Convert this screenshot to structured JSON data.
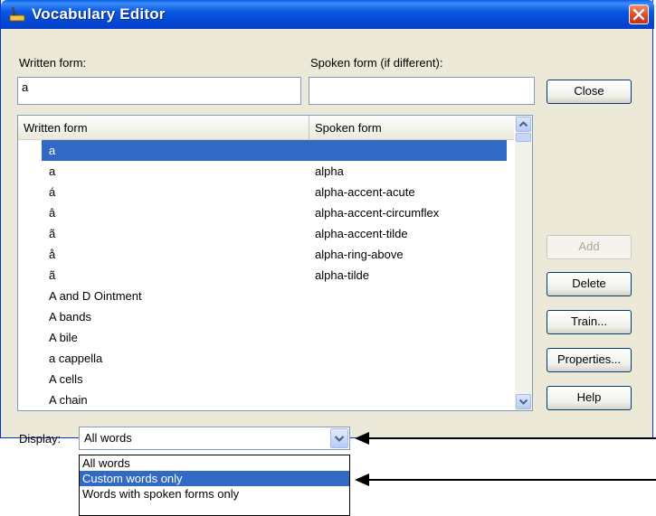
{
  "window": {
    "title": "Vocabulary Editor"
  },
  "labels": {
    "written_form": "Written form:",
    "spoken_form": "Spoken form (if different):",
    "display": "Display:"
  },
  "inputs": {
    "written_value": "a",
    "spoken_value": ""
  },
  "buttons": {
    "close": "Close",
    "add": "Add",
    "delete": "Delete",
    "train": "Train...",
    "properties": "Properties...",
    "help": "Help"
  },
  "list": {
    "columns": [
      "Written form",
      "Spoken form"
    ],
    "rows": [
      {
        "written": "a",
        "spoken": "",
        "selected": true
      },
      {
        "written": "a",
        "spoken": "alpha"
      },
      {
        "written": "á",
        "spoken": "alpha-accent-acute"
      },
      {
        "written": "â",
        "spoken": "alpha-accent-circumflex"
      },
      {
        "written": "ã",
        "spoken": "alpha-accent-tilde"
      },
      {
        "written": "å",
        "spoken": "alpha-ring-above"
      },
      {
        "written": "ã",
        "spoken": "alpha-tilde"
      },
      {
        "written": "A and D Ointment",
        "spoken": ""
      },
      {
        "written": "A bands",
        "spoken": ""
      },
      {
        "written": "A bile",
        "spoken": ""
      },
      {
        "written": "a cappella",
        "spoken": ""
      },
      {
        "written": "A cells",
        "spoken": ""
      },
      {
        "written": "A chain",
        "spoken": ""
      }
    ]
  },
  "display_select": {
    "value": "All words",
    "options": [
      "All words",
      "Custom words only",
      "Words with spoken forms only"
    ],
    "highlighted": "Custom words only"
  },
  "colors": {
    "title_blue": "#0a58e0",
    "selection": "#316ac5",
    "dialog_bg": "#ece9d8",
    "close_red": "#d8492a"
  }
}
